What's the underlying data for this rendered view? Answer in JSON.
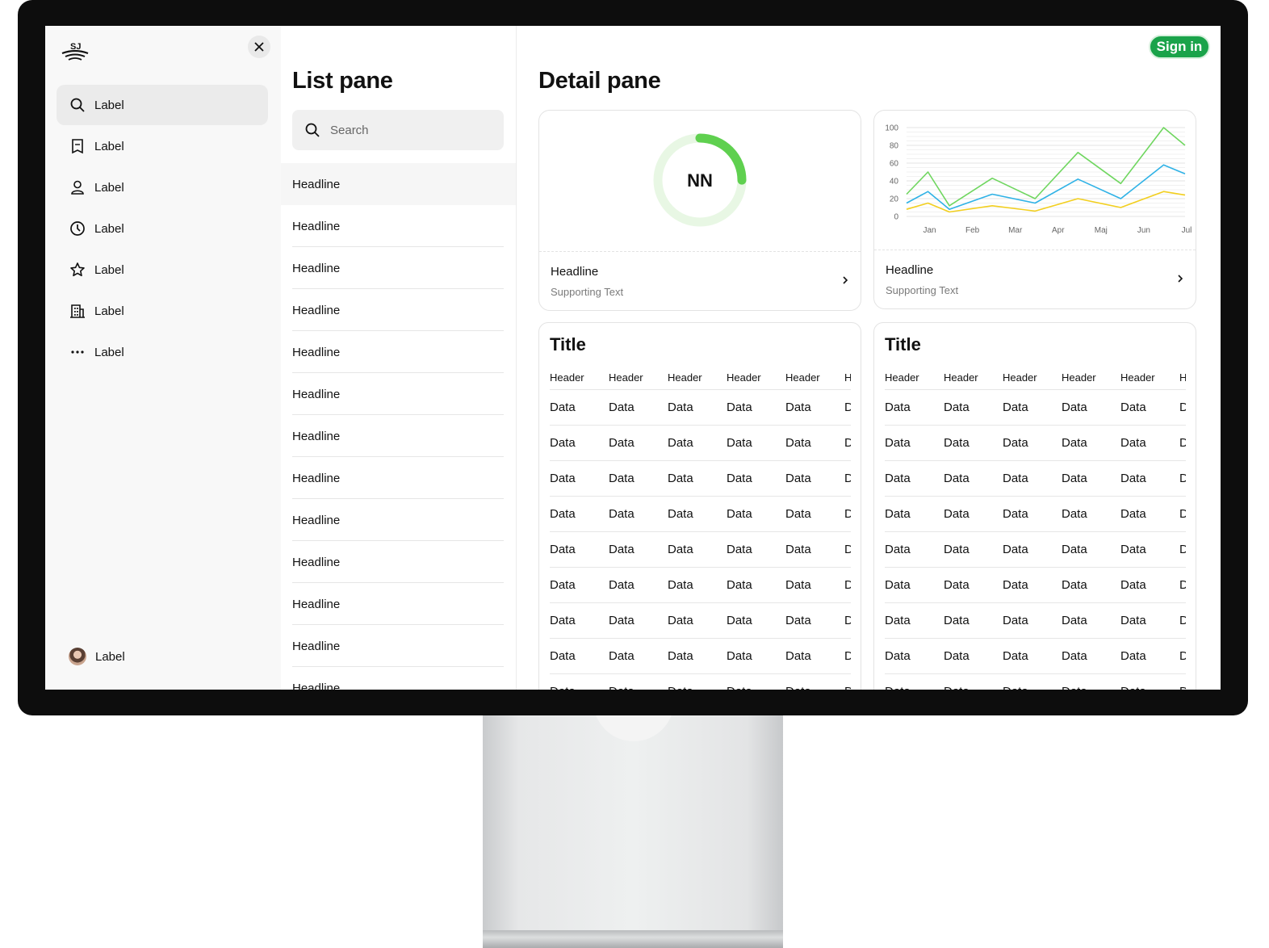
{
  "nav": {
    "items": [
      {
        "label": "Label",
        "icon": "search-icon",
        "active": true
      },
      {
        "label": "Label",
        "icon": "bookmark-icon",
        "active": false
      },
      {
        "label": "Label",
        "icon": "person-icon",
        "active": false
      },
      {
        "label": "Label",
        "icon": "clock-icon",
        "active": false
      },
      {
        "label": "Label",
        "icon": "star-icon",
        "active": false
      },
      {
        "label": "Label",
        "icon": "building-icon",
        "active": false
      },
      {
        "label": "Label",
        "icon": "more-icon",
        "active": false
      }
    ],
    "profile_label": "Label"
  },
  "list_pane": {
    "title": "List pane",
    "search_placeholder": "Search",
    "items": [
      "Headline",
      "Headline",
      "Headline",
      "Headline",
      "Headline",
      "Headline",
      "Headline",
      "Headline",
      "Headline",
      "Headline",
      "Headline",
      "Headline",
      "Headline"
    ]
  },
  "detail_pane": {
    "title": "Detail pane",
    "sign_in": "Sign in",
    "gauge_card": {
      "center_text": "NN",
      "headline": "Headline",
      "supporting": "Supporting Text",
      "progress": 0.25
    },
    "chart_card": {
      "headline": "Headline",
      "supporting": "Supporting Text"
    },
    "tables": [
      {
        "title": "Title",
        "headers": [
          "Header",
          "Header",
          "Header",
          "Header",
          "Header",
          "Header"
        ],
        "rows": [
          [
            "Data",
            "Data",
            "Data",
            "Data",
            "Data",
            "Data"
          ],
          [
            "Data",
            "Data",
            "Data",
            "Data",
            "Data",
            "Data"
          ],
          [
            "Data",
            "Data",
            "Data",
            "Data",
            "Data",
            "Data"
          ],
          [
            "Data",
            "Data",
            "Data",
            "Data",
            "Data",
            "Data"
          ],
          [
            "Data",
            "Data",
            "Data",
            "Data",
            "Data",
            "Data"
          ],
          [
            "Data",
            "Data",
            "Data",
            "Data",
            "Data",
            "Data"
          ],
          [
            "Data",
            "Data",
            "Data",
            "Data",
            "Data",
            "Data"
          ],
          [
            "Data",
            "Data",
            "Data",
            "Data",
            "Data",
            "Data"
          ],
          [
            "Data",
            "Data",
            "Data",
            "Data",
            "Data",
            "Data"
          ]
        ]
      },
      {
        "title": "Title",
        "headers": [
          "Header",
          "Header",
          "Header",
          "Header",
          "Header",
          "Header"
        ],
        "rows": [
          [
            "Data",
            "Data",
            "Data",
            "Data",
            "Data",
            "Data"
          ],
          [
            "Data",
            "Data",
            "Data",
            "Data",
            "Data",
            "Data"
          ],
          [
            "Data",
            "Data",
            "Data",
            "Data",
            "Data",
            "Data"
          ],
          [
            "Data",
            "Data",
            "Data",
            "Data",
            "Data",
            "Data"
          ],
          [
            "Data",
            "Data",
            "Data",
            "Data",
            "Data",
            "Data"
          ],
          [
            "Data",
            "Data",
            "Data",
            "Data",
            "Data",
            "Data"
          ],
          [
            "Data",
            "Data",
            "Data",
            "Data",
            "Data",
            "Data"
          ],
          [
            "Data",
            "Data",
            "Data",
            "Data",
            "Data",
            "Data"
          ],
          [
            "Data",
            "Data",
            "Data",
            "Data",
            "Data",
            "Data"
          ]
        ]
      }
    ]
  },
  "colors": {
    "accent": "#1aa34a",
    "series_green": "#6fd65f",
    "series_blue": "#2fb2e6",
    "series_yellow": "#f2cf1f",
    "gauge_track": "#e8f7e4"
  },
  "chart_data": {
    "type": "line",
    "categories": [
      "Jan",
      "Feb",
      "Mar",
      "Apr",
      "Maj",
      "Jun",
      "Jul"
    ],
    "ylim": [
      0,
      100
    ],
    "yticks": [
      0,
      20,
      40,
      60,
      80,
      100
    ],
    "grid": true,
    "series": [
      {
        "values": [
          25,
          50,
          12,
          43,
          20,
          72,
          37,
          100,
          80
        ]
      },
      {
        "values": [
          15,
          28,
          8,
          25,
          15,
          42,
          20,
          58,
          48
        ]
      },
      {
        "values": [
          8,
          15,
          5,
          12,
          6,
          20,
          10,
          28,
          24
        ]
      }
    ],
    "x_positions": [
      0.0,
      0.5,
      1.0,
      2.0,
      3.0,
      4.0,
      5.0,
      6.0,
      6.5
    ]
  }
}
